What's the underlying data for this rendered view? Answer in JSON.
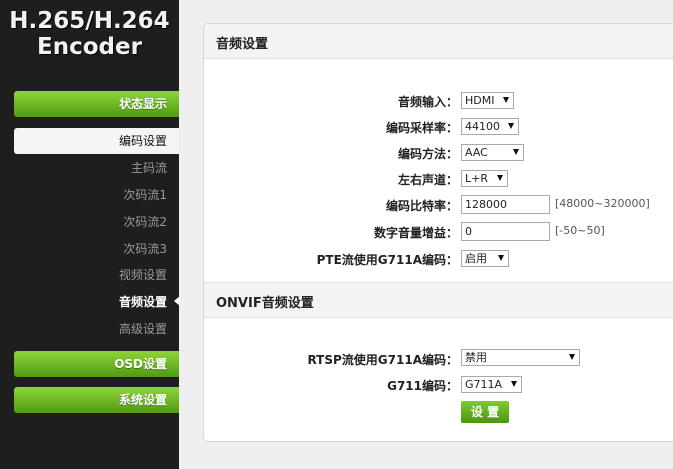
{
  "logo": {
    "line1": "H.265/H.264",
    "line2": "Encoder"
  },
  "nav": {
    "status": "状态显示",
    "encode": "编码设置",
    "sub_items": [
      "主码流",
      "次码流1",
      "次码流2",
      "次码流3",
      "视频设置",
      "音频设置",
      "高级设置"
    ],
    "selected_sub": "音频设置",
    "osd": "OSD设置",
    "system": "系统设置"
  },
  "audio": {
    "title": "音频设置",
    "input_label": "音频输入：",
    "input_value": "HDMI",
    "samplerate_label": "编码采样率：",
    "samplerate_value": "44100",
    "method_label": "编码方法：",
    "method_value": "AAC",
    "channel_label": "左右声道：",
    "channel_value": "L+R",
    "bitrate_label": "编码比特率：",
    "bitrate_value": "128000",
    "bitrate_hint": "[48000~320000]",
    "gain_label": "数字音量增益：",
    "gain_value": "0",
    "gain_hint": "[-50~50]",
    "pte_label": "PTE流使用G711A编码：",
    "pte_value": "启用"
  },
  "onvif": {
    "title": "ONVIF音频设置",
    "rtsp_label": "RTSP流使用G711A编码：",
    "rtsp_value": "禁用",
    "g711_label": "G711编码：",
    "g711_value": "G711A",
    "set_label": "设 置"
  },
  "colors": {
    "accent_green": "#5fae1c",
    "sidebar_bg": "#1e1e1e"
  }
}
